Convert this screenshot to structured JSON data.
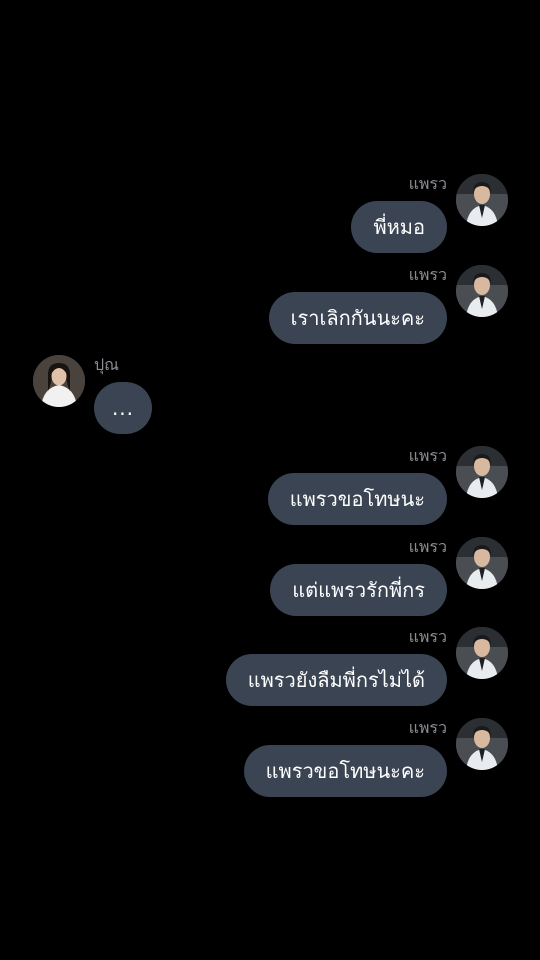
{
  "colors": {
    "background": "#000000",
    "bubble": "#3a4452",
    "bubble_text": "#ffffff",
    "sender_text": "#8a8d92"
  },
  "messages": [
    {
      "side": "right",
      "sender": "แพรว",
      "text": "พี่หมอ",
      "avatar_icon": "avatar-praew-icon"
    },
    {
      "side": "right",
      "sender": "แพรว",
      "text": "เราเลิกกันนะคะ",
      "avatar_icon": "avatar-praew-icon"
    },
    {
      "side": "left",
      "sender": "ปุณ",
      "text": "...",
      "avatar_icon": "avatar-pun-icon"
    },
    {
      "side": "right",
      "sender": "แพรว",
      "text": "แพรวขอโทษนะ",
      "avatar_icon": "avatar-praew-icon"
    },
    {
      "side": "right",
      "sender": "แพรว",
      "text": "แต่แพรวรักพี่กร",
      "avatar_icon": "avatar-praew-icon"
    },
    {
      "side": "right",
      "sender": "แพรว",
      "text": "แพรวยังลืมพี่กรไม่ได้",
      "avatar_icon": "avatar-praew-icon"
    },
    {
      "side": "right",
      "sender": "แพรว",
      "text": "แพรวขอโทษนะคะ",
      "avatar_icon": "avatar-praew-icon"
    }
  ]
}
